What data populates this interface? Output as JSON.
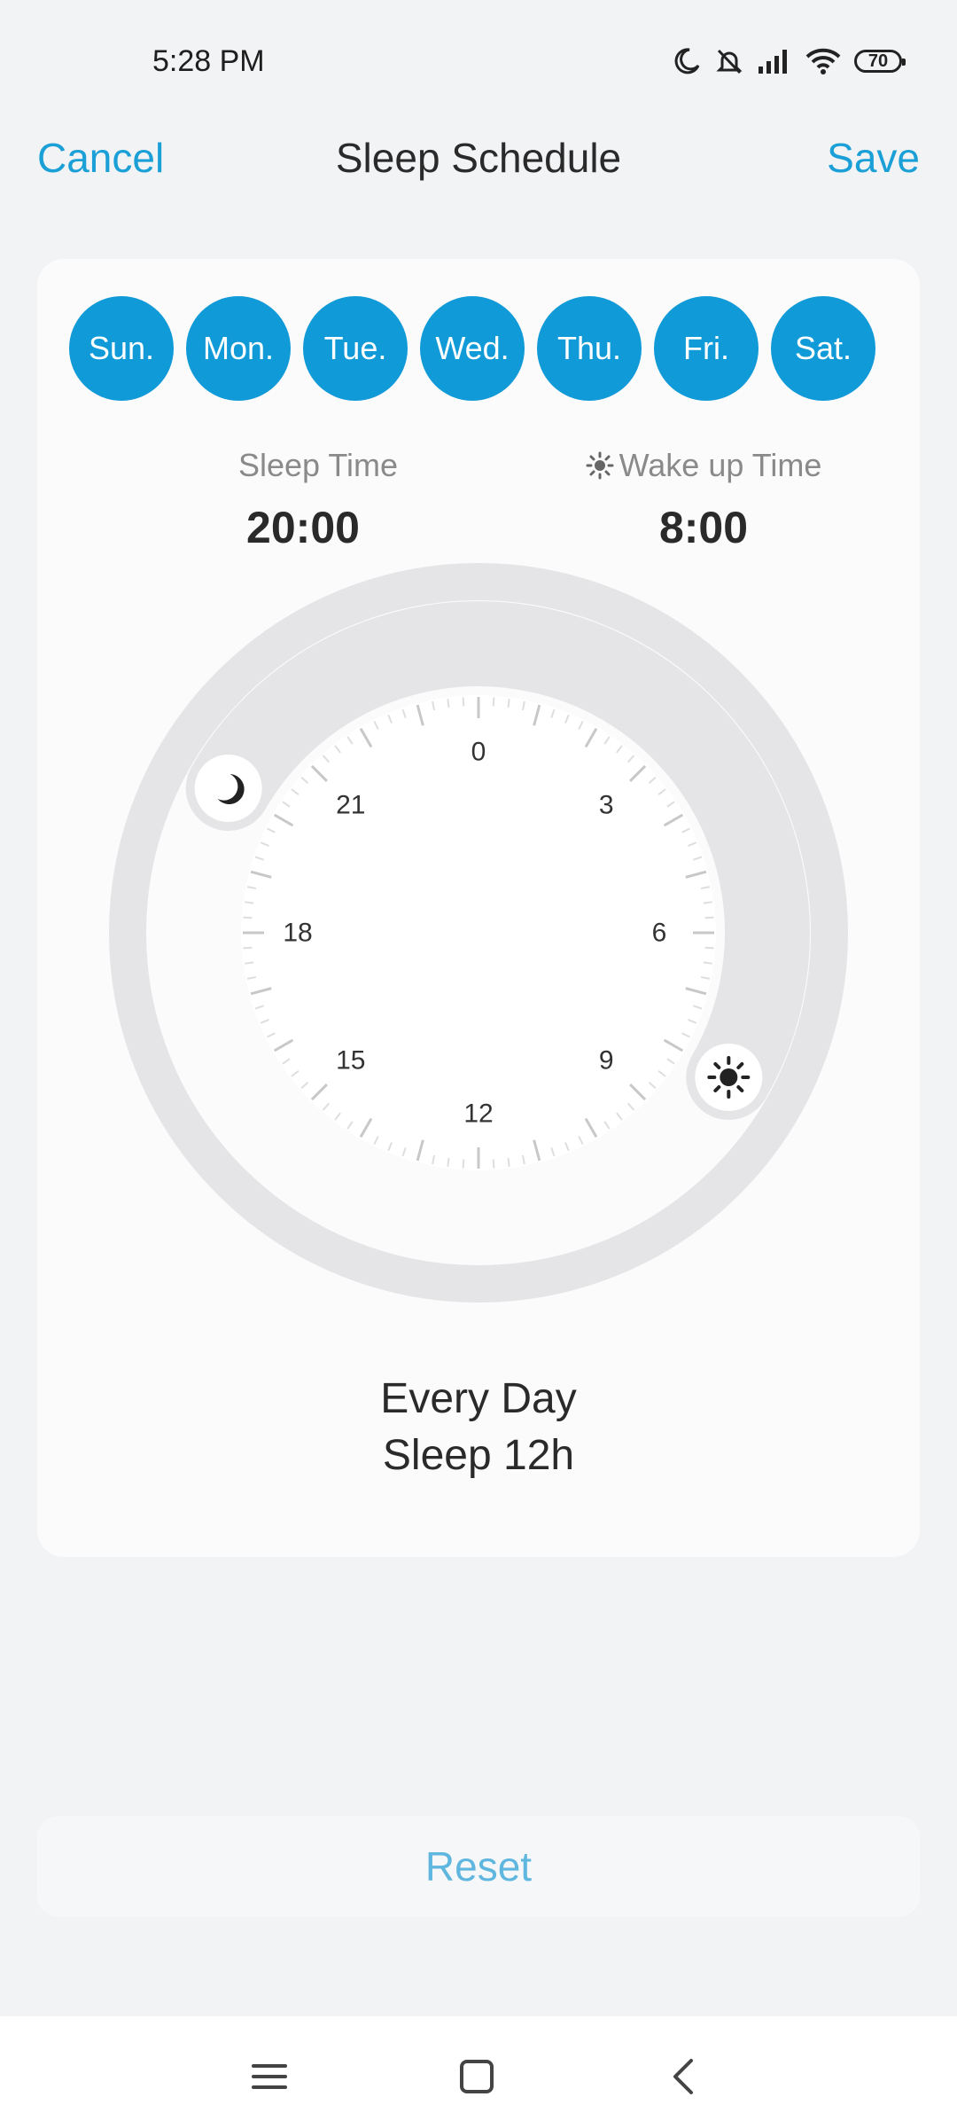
{
  "status_bar": {
    "time": "5:28 PM",
    "battery": "70",
    "icons": [
      "moon-icon",
      "bell-off-icon",
      "signal-icon",
      "wifi-icon",
      "battery-icon"
    ]
  },
  "header": {
    "cancel_label": "Cancel",
    "title": "Sleep Schedule",
    "save_label": "Save"
  },
  "days": [
    "Sun.",
    "Mon.",
    "Tue.",
    "Wed.",
    "Thu.",
    "Fri.",
    "Sat."
  ],
  "sleep": {
    "label": "Sleep Time",
    "value": "20:00"
  },
  "wake": {
    "label": "Wake up Time",
    "value": "8:00"
  },
  "dial": {
    "hour_labels": [
      "0",
      "3",
      "6",
      "9",
      "12",
      "15",
      "18",
      "21"
    ],
    "sleep_hour": 20,
    "wake_hour": 8,
    "icons": [
      "moon-icon",
      "sun-icon"
    ]
  },
  "summary": {
    "line1": "Every Day",
    "line2": "Sleep 12h"
  },
  "reset_label": "Reset",
  "colors": {
    "accent": "#1a9fd6",
    "day_pill": "#119ad8",
    "track": "#e5e5e7",
    "reset_text": "#5fb6de"
  },
  "navbar": {
    "icons": [
      "menu-icon",
      "home-icon",
      "back-icon"
    ]
  }
}
